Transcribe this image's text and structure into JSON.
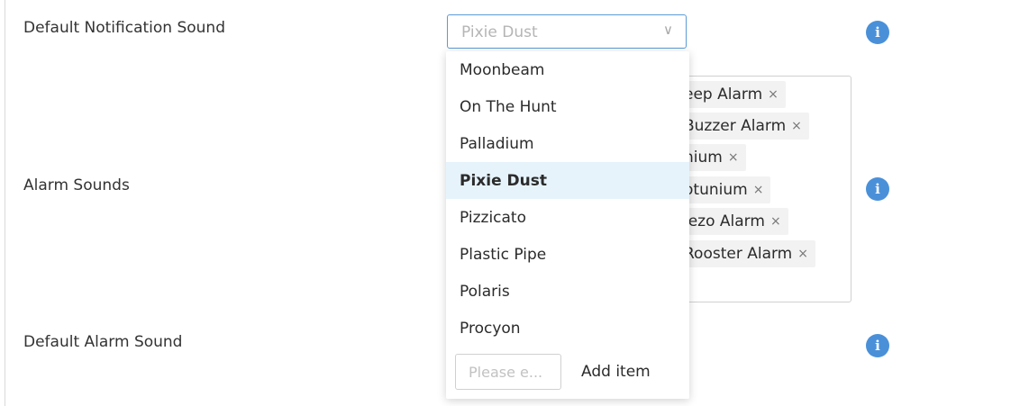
{
  "rows": {
    "notification": {
      "label": "Default Notification Sound",
      "selected_value": "Pixie Dust"
    },
    "alarms": {
      "label": "Alarm Sounds",
      "tags": [
        "eep Alarm",
        "Buzzer Alarm",
        "nium",
        "otunium",
        "iezo Alarm",
        "Rooster Alarm"
      ]
    },
    "alarm_default": {
      "label": "Default Alarm Sound"
    }
  },
  "dropdown": {
    "options": [
      "Moonbeam",
      "On The Hunt",
      "Palladium",
      "Pixie Dust",
      "Pizzicato",
      "Plastic Pipe",
      "Polaris",
      "Procyon"
    ],
    "selected": "Pixie Dust",
    "add_item": {
      "placeholder": "Please e...",
      "button_label": "Add item"
    }
  },
  "icons": {
    "info": "i",
    "chevron": "∨",
    "tag_remove": "×"
  },
  "colors": {
    "accent": "#4a90d9",
    "selected_bg": "#e6f3fb",
    "focus_border": "#5b9bd5"
  }
}
